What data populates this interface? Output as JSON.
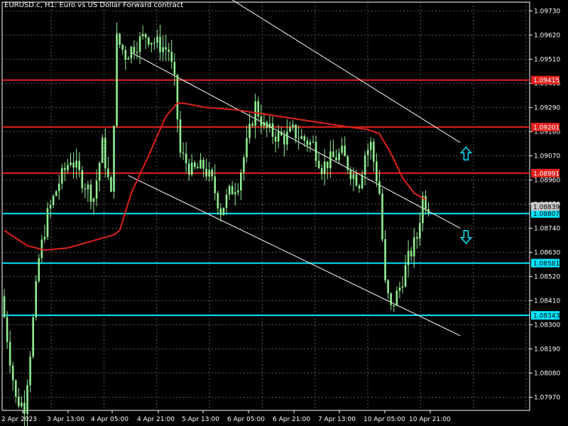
{
  "header": {
    "symbol": "EURUSD.c, H1:",
    "description": "Euro vs US Dollar Forward contract"
  },
  "colors": {
    "background": "#000000",
    "grid": "#5a5a5a",
    "candle": "#90ee90",
    "ma": "#e0201b",
    "resistance": "#e0201b",
    "support": "#00e5ff",
    "channel": "#ffffff",
    "arrow": "#00e5ff"
  },
  "chart_data": {
    "type": "candlestick",
    "title": "",
    "ylim": [
      1.0791,
      1.0977
    ],
    "y_ticks": [
      "1.09730",
      "1.09620",
      "1.09510",
      "1.09400",
      "1.09290",
      "1.09180",
      "1.09070",
      "1.08960",
      "1.08850",
      "1.08740",
      "1.08630",
      "1.08520",
      "1.08410",
      "1.08300",
      "1.08190",
      "1.08080",
      "1.07970"
    ],
    "x_ticks": [
      "2 Apr 2023",
      "3 Apr 13:00",
      "4 Apr 05:00",
      "4 Apr 21:00",
      "5 Apr 13:00",
      "6 Apr 05:00",
      "6 Apr 21:00",
      "7 Apr 13:00",
      "10 Apr 05:00",
      "10 Apr 21:00"
    ],
    "bars": 148,
    "price_path": [
      [
        0,
        1.0843
      ],
      [
        5,
        1.0796
      ],
      [
        8,
        1.0793
      ],
      [
        10,
        1.0818
      ],
      [
        13,
        1.086
      ],
      [
        16,
        1.088
      ],
      [
        20,
        1.0895
      ],
      [
        24,
        1.0906
      ],
      [
        28,
        1.0896
      ],
      [
        32,
        1.0888
      ],
      [
        35,
        1.0912
      ],
      [
        38,
        1.0888
      ],
      [
        40,
        1.096
      ],
      [
        43,
        1.0953
      ],
      [
        46,
        1.0957
      ],
      [
        50,
        1.0962
      ],
      [
        54,
        1.0958
      ],
      [
        58,
        1.0955
      ],
      [
        60,
        1.094
      ],
      [
        62,
        1.0908
      ],
      [
        66,
        1.09
      ],
      [
        70,
        1.0902
      ],
      [
        73,
        1.0895
      ],
      [
        76,
        1.0882
      ],
      [
        79,
        1.089
      ],
      [
        82,
        1.0895
      ],
      [
        85,
        1.0912
      ],
      [
        88,
        1.093
      ],
      [
        91,
        1.092
      ],
      [
        94,
        1.0917
      ],
      [
        98,
        1.0915
      ],
      [
        101,
        1.0918
      ],
      [
        104,
        1.0915
      ],
      [
        108,
        1.0912
      ],
      [
        111,
        1.0902
      ],
      [
        114,
        1.0905
      ],
      [
        118,
        1.0908
      ],
      [
        121,
        1.09
      ],
      [
        124,
        1.0895
      ],
      [
        126,
        1.0908
      ],
      [
        128,
        1.0912
      ],
      [
        131,
        1.089
      ],
      [
        133,
        1.0848
      ],
      [
        135,
        1.0837
      ],
      [
        138,
        1.0847
      ],
      [
        141,
        1.086
      ],
      [
        144,
        1.087
      ],
      [
        146,
        1.0888
      ],
      [
        148,
        1.0884
      ]
    ],
    "moving_average": [
      [
        0,
        1.0873
      ],
      [
        8,
        1.0866
      ],
      [
        14,
        1.0864
      ],
      [
        22,
        1.0865
      ],
      [
        30,
        1.0868
      ],
      [
        38,
        1.0871
      ],
      [
        40,
        1.0873
      ],
      [
        44,
        1.089
      ],
      [
        50,
        1.0907
      ],
      [
        56,
        1.0925
      ],
      [
        60,
        1.0931
      ],
      [
        62,
        1.0931
      ],
      [
        70,
        1.0929
      ],
      [
        80,
        1.0928
      ],
      [
        90,
        1.0926
      ],
      [
        100,
        1.0924
      ],
      [
        110,
        1.0922
      ],
      [
        120,
        1.092
      ],
      [
        126,
        1.0919
      ],
      [
        130,
        1.0917
      ],
      [
        134,
        1.0908
      ],
      [
        138,
        1.0897
      ],
      [
        142,
        1.089
      ],
      [
        146,
        1.0887
      ]
    ],
    "resistance_lines": [
      {
        "price": 1.09415,
        "label": "1.09415"
      },
      {
        "price": 1.09201,
        "label": "1.09201"
      },
      {
        "price": 1.08991,
        "label": "1.08991"
      }
    ],
    "support_lines": [
      {
        "price": 1.08807,
        "label": "1.08807"
      },
      {
        "price": 1.08581,
        "label": "1.08581"
      },
      {
        "price": 1.08343,
        "label": "1.08343"
      }
    ],
    "current_price": {
      "price": 1.08839,
      "label": "1.08839"
    },
    "channel_lines": [
      [
        [
          62,
          1.0992
        ],
        [
          158,
          1.0913
        ]
      ],
      [
        [
          44,
          1.0954
        ],
        [
          158,
          1.0874
        ]
      ],
      [
        [
          43,
          1.0898
        ],
        [
          158,
          1.0825
        ]
      ]
    ],
    "arrows": [
      {
        "direction": "up",
        "bar": 160,
        "price": 1.0908
      },
      {
        "direction": "down",
        "bar": 160,
        "price": 1.087
      }
    ]
  }
}
